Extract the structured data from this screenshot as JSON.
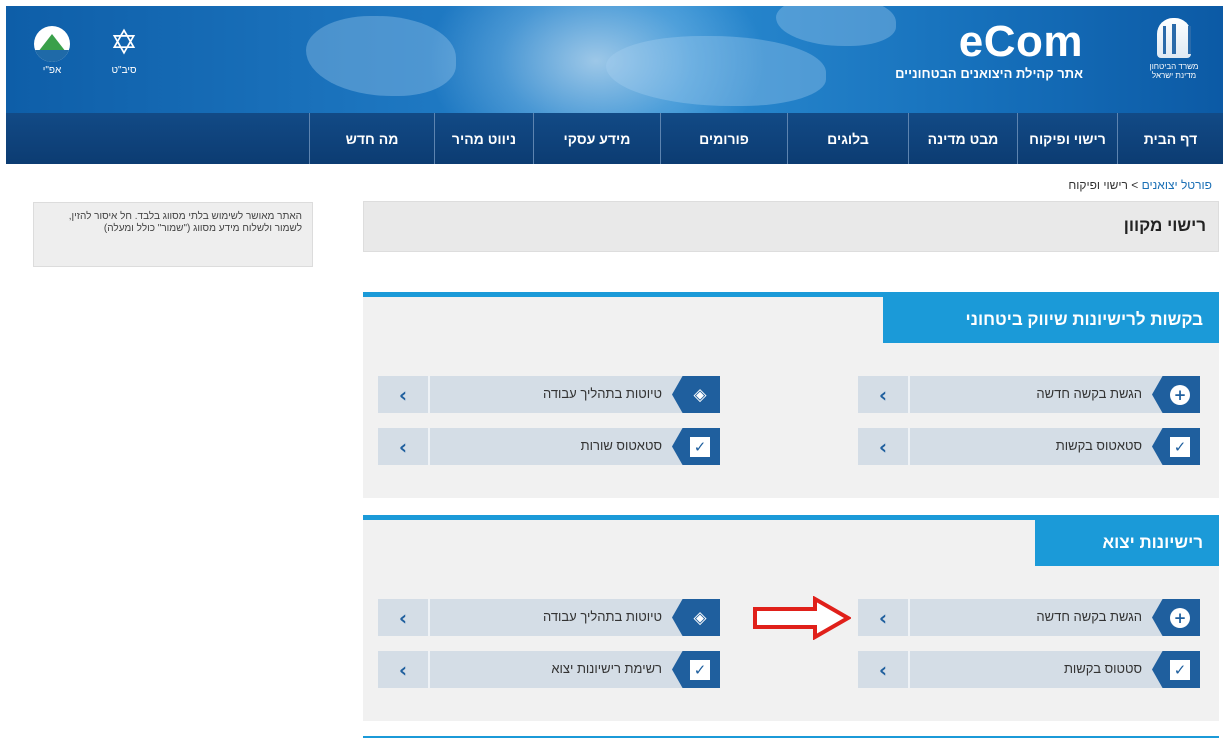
{
  "header": {
    "site_title": "eCom",
    "site_subtitle": "אתר קהילת היצואנים הבטחוניים",
    "ministry_line1": "משרד הביטחון",
    "ministry_line2": "מדינת ישראל",
    "logo_a_label": "אפ\"י",
    "logo_b_label": "סיב\"ט"
  },
  "nav": {
    "items": [
      "דף הבית",
      "רישוי ופיקוח",
      "מבט מדינה",
      "בלוגים",
      "פורומים",
      "מידע עסקי",
      "ניווט מהיר",
      "מה חדש"
    ]
  },
  "breadcrumb": {
    "root": "פורטל יצואנים",
    "separator": ">",
    "current": "רישוי ופיקוח"
  },
  "notice": {
    "text": "האתר מאושר לשימוש בלתי מסווג בלבד. חל איסור להזין, לשמור ולשלוח מידע מסווג (\"שמור\" כולל ומעלה)"
  },
  "page": {
    "title": "רישוי מקוון"
  },
  "sections": [
    {
      "title": "בקשות לרישיונות שיווק ביטחוני",
      "tiles": [
        {
          "label": "הגשת בקשה חדשה",
          "icon": "plus-icon"
        },
        {
          "label": "טיוטות בתהליך עבודה",
          "icon": "layers-icon"
        },
        {
          "label": "סטאטוס בקשות",
          "icon": "checkbox-icon"
        },
        {
          "label": "סטאטוס שורות",
          "icon": "checkbox-icon"
        }
      ]
    },
    {
      "title": "רישיונות יצוא",
      "tiles": [
        {
          "label": "הגשת בקשה חדשה",
          "icon": "plus-icon"
        },
        {
          "label": "טיוטות בתהליך עבודה",
          "icon": "layers-icon"
        },
        {
          "label": "סטטוס בקשות",
          "icon": "checkbox-icon"
        },
        {
          "label": "רשימת רישיונות יצוא",
          "icon": "checkbox-icon"
        }
      ]
    }
  ],
  "glyphs": {
    "chevron": "‹",
    "plus": "+",
    "check": "✓",
    "layers": "◈",
    "star": "✡"
  },
  "colors": {
    "header_blue": "#1670bb",
    "nav_blue": "#0c3c72",
    "section_accent": "#1b9ad8",
    "tile_bg": "#d4dde6",
    "icon_blue": "#1f5f9e",
    "arrow_red": "#e0201a"
  }
}
